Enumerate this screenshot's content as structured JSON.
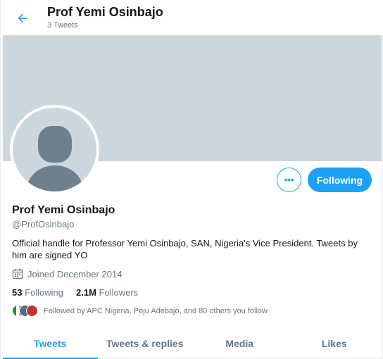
{
  "header": {
    "title": "Prof Yemi Osinbajo",
    "tweet_count": "3 Tweets"
  },
  "profile": {
    "name": "Prof Yemi Osinbajo",
    "handle": "@ProfOsinbajo",
    "bio": "Official handle for Professor Yemi Osinbajo, SAN, Nigeria's Vice President. Tweets by him are signed YO",
    "joined": "Joined December 2014",
    "following_count": "53",
    "following_label": "Following",
    "followers_count": "2.1M",
    "followers_label": "Followers",
    "followed_by": "Followed by APC Nigeria, Peju Adebajo, and 80 others you follow"
  },
  "actions": {
    "more_label": "•••",
    "follow_state_label": "Following"
  },
  "tabs": [
    {
      "label": "Tweets",
      "active": true
    },
    {
      "label": "Tweets & replies",
      "active": false
    },
    {
      "label": "Media",
      "active": false
    },
    {
      "label": "Likes",
      "active": false
    }
  ],
  "colors": {
    "accent": "#1da1f2",
    "banner": "#ccd6dd",
    "secondary_text": "#657786"
  },
  "icons": {
    "back": "arrow-left-icon",
    "calendar": "calendar-icon",
    "more": "more-dots-icon"
  }
}
